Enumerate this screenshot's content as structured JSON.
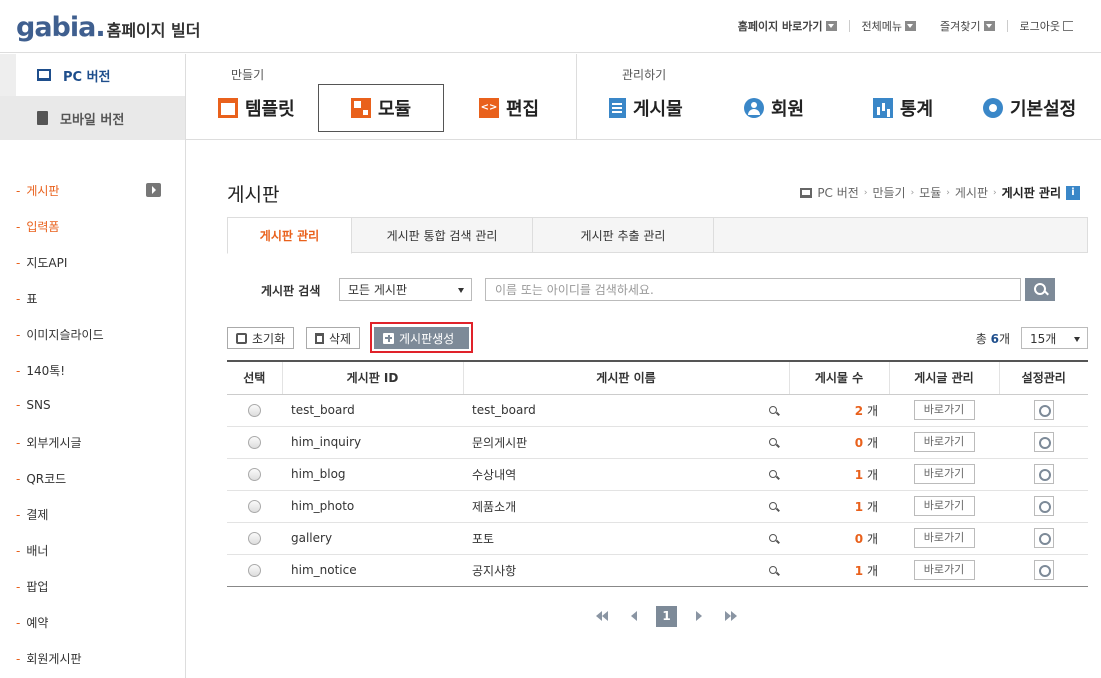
{
  "header": {
    "logo_text": "gabia.",
    "logo_sub": "홈페이지 빌더",
    "links": [
      {
        "label": "홈페이지 바로가기"
      },
      {
        "label": "전체메뉴"
      },
      {
        "label": "즐겨찾기"
      },
      {
        "label": "로그아웃"
      }
    ]
  },
  "nav": {
    "pc_version": "PC 버전",
    "mobile_version": "모바일 버전",
    "make_label": "만들기",
    "manage_label": "관리하기",
    "make_menu": [
      "템플릿",
      "모듈",
      "편집"
    ],
    "manage_menu": [
      "게시물",
      "회원",
      "통계",
      "기본설정"
    ],
    "edit_icon_text": "<>"
  },
  "sidebar": {
    "items": [
      "게시판",
      "입력폼",
      "지도API",
      "표",
      "이미지슬라이드",
      "140톡!",
      "SNS",
      "외부게시글",
      "QR코드",
      "결제",
      "배너",
      "팝업",
      "예약",
      "회원게시판"
    ],
    "dash": "-"
  },
  "main": {
    "title": "게시판",
    "breadcrumb": [
      "PC 버전",
      "만들기",
      "모듈",
      "게시판",
      "게시판 관리"
    ],
    "breadcrumb_sep": "›",
    "info_icon": "i",
    "tabs": [
      "게시판 관리",
      "게시판 통합 검색 관리",
      "게시판 추출 관리"
    ],
    "search": {
      "label": "게시판 검색",
      "select_value": "모든 게시판",
      "placeholder": "이름 또는 아이디를 검색하세요."
    },
    "buttons": {
      "reset": "초기화",
      "delete": "삭제",
      "create": "게시판생성"
    },
    "total_prefix": "총",
    "total_count": "6",
    "total_suffix": "개",
    "per_page": "15개",
    "table": {
      "headers": [
        "선택",
        "게시판 ID",
        "게시판 이름",
        "게시물 수",
        "게시글 관리",
        "설정관리"
      ],
      "unit": "개",
      "goto_label": "바로가기",
      "rows": [
        {
          "id": "test_board",
          "name": "test_board",
          "count": "2"
        },
        {
          "id": "him_inquiry",
          "name": "문의게시판",
          "count": "0"
        },
        {
          "id": "him_blog",
          "name": "수상내역",
          "count": "1"
        },
        {
          "id": "him_photo",
          "name": "제품소개",
          "count": "1"
        },
        {
          "id": "gallery",
          "name": "포토",
          "count": "0"
        },
        {
          "id": "him_notice",
          "name": "공지사항",
          "count": "1"
        }
      ]
    },
    "pagination": {
      "current": "1"
    }
  },
  "colors": {
    "accent": "#e9611c",
    "brand": "#3f5f8f",
    "link_blue": "#1e4e8c",
    "highlight": "#e0222a"
  }
}
